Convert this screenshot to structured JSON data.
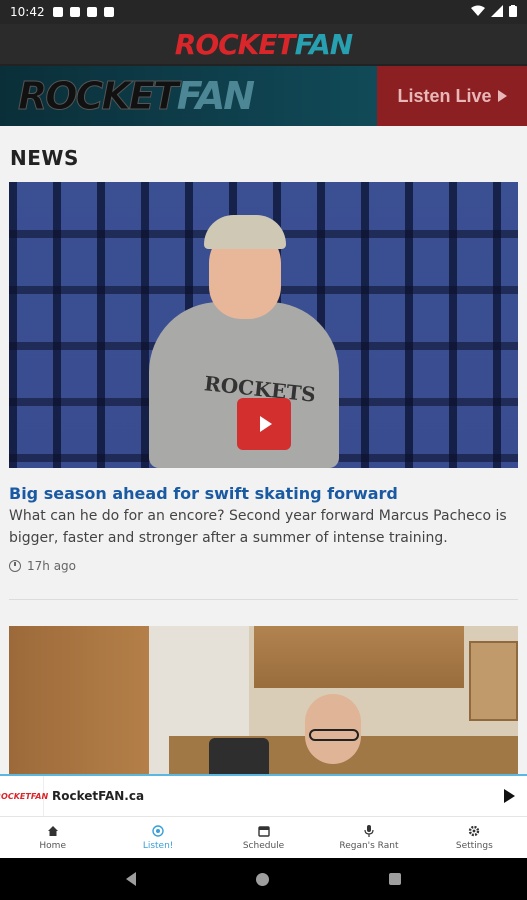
{
  "status_bar": {
    "time": "10:42"
  },
  "app_bar": {
    "logo_part1": "ROCKET",
    "logo_part2": "FAN"
  },
  "banner": {
    "logo_part1": "ROCKET",
    "logo_part2": "FAN",
    "listen_live": "Listen Live"
  },
  "news": {
    "section_title": "NEWS",
    "articles": [
      {
        "headline": "Big season ahead for swift skating forward",
        "summary": "What can he do for an encore? Second year forward Marcus Pacheco is bigger, faster and stronger after a summer of intense training.",
        "time_ago": "17h ago",
        "image_text": "ROCKETS"
      }
    ]
  },
  "player": {
    "logo": "ROCKETFAN",
    "title": "RocketFAN.ca"
  },
  "bottom_nav": {
    "items": [
      {
        "label": "Home",
        "icon": "home-icon",
        "active": false
      },
      {
        "label": "Listen!",
        "icon": "radio-icon",
        "active": true
      },
      {
        "label": "Schedule",
        "icon": "calendar-icon",
        "active": false
      },
      {
        "label": "Regan's Rant",
        "icon": "mic-icon",
        "active": false
      },
      {
        "label": "Settings",
        "icon": "gear-icon",
        "active": false
      }
    ]
  },
  "colors": {
    "brand_red": "#d9262b",
    "brand_teal": "#27a0b1",
    "headline_blue": "#1a5aa3",
    "nav_active": "#3aa0d8"
  }
}
